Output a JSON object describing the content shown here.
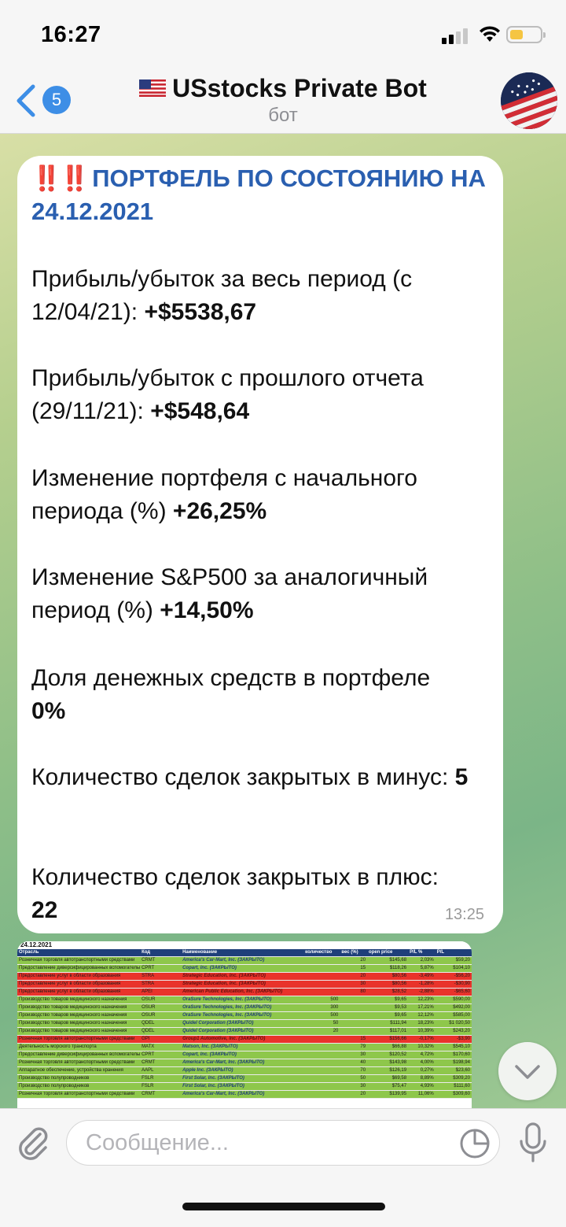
{
  "status_bar": {
    "time": "16:27"
  },
  "header": {
    "back_badge": "5",
    "title": "USstocks Private Bot",
    "subtitle": "бот"
  },
  "message": {
    "title_bangs": "‼️‼️",
    "title": "ПОРТФЕЛЬ ПО СОСТОЯНИЮ НА 24.12.2021",
    "paragraphs": [
      {
        "text": "Прибыль/убыток за весь период (с 12/04/21): ",
        "value": "+$5538,67"
      },
      {
        "text": "Прибыль/убыток с прошлого отчета (29/11/21): ",
        "value": "+$548,64"
      },
      {
        "text": "Изменение портфеля с начального периода (%) ",
        "value": "+26,25%"
      },
      {
        "text": "Изменение S&P500 за аналогичный период (%) ",
        "value": "+14,50%"
      },
      {
        "text": "Доля денежных средств в портфеле ",
        "value": "0%"
      },
      {
        "text": "Количество сделок закрытых в минус: ",
        "value": "5"
      },
      {
        "text": "Количество сделок закрытых в плюс: ",
        "value": "22"
      }
    ],
    "time": "13:25"
  },
  "photo": {
    "date": "24.12.2021",
    "columns": [
      "Отрасль",
      "Код",
      "Наименование",
      "количество",
      "вес (%)",
      "open price",
      "P/L %",
      "P/L"
    ],
    "rows": [
      {
        "s": "g",
        "c": [
          "Розничная торговля автотранспортными средствами",
          "CRMT",
          "America's Car-Mart, Inc. (ЗАКРЫТО)",
          "",
          "20",
          "$145,68",
          "2,03%",
          "$59,20"
        ]
      },
      {
        "s": "g",
        "c": [
          "Предоставление диверсифицированных вспомогательных",
          "CPRT",
          "Copart, Inc. (ЗАКРЫТО)",
          "",
          "15",
          "$118,26",
          "5,87%",
          "$104,10"
        ]
      },
      {
        "s": "r",
        "c": [
          "Предоставление услуг в области образования",
          "STRA",
          "Strategic Education, Inc. (ЗАКРЫТО)",
          "",
          "20",
          "$80,56",
          "-3,49%",
          "-$56,20"
        ]
      },
      {
        "s": "r",
        "c": [
          "Предоставление услуг в области образования",
          "STRA",
          "Strategic Education, Inc. (ЗАКРЫТО)",
          "",
          "30",
          "$80,56",
          "-1,28%",
          "-$30,90"
        ]
      },
      {
        "s": "r",
        "c": [
          "Предоставление услуг в области образования",
          "APEI",
          "American Public Education, Inc. (ЗАКРЫТО)",
          "",
          "80",
          "$28,52",
          "-2,88%",
          "-$65,60"
        ]
      },
      {
        "s": "g",
        "c": [
          "Производство товаров медицинского назначения",
          "OSUR",
          "OraSure Technologies, Inc. (ЗАКРЫТО)",
          "500",
          "",
          "$9,65",
          "12,23%",
          "$590,00"
        ]
      },
      {
        "s": "g",
        "c": [
          "Производство товаров медицинского назначения",
          "OSUR",
          "OraSure Technologies, Inc. (ЗАКРЫТО)",
          "300",
          "",
          "$9,53",
          "17,21%",
          "$492,00"
        ]
      },
      {
        "s": "g",
        "c": [
          "Производство товаров медицинского назначения",
          "OSUR",
          "OraSure Technologies, Inc. (ЗАКРЫТО)",
          "500",
          "",
          "$9,65",
          "12,12%",
          "$585,00"
        ]
      },
      {
        "s": "g",
        "c": [
          "Производство товаров медицинского назначения",
          "QDEL",
          "Quidel Corporation (ЗАКРЫТО)",
          "50",
          "",
          "$111,94",
          "18,23%",
          "$1 020,50"
        ]
      },
      {
        "s": "g",
        "c": [
          "Производство товаров медицинского назначения",
          "QDEL",
          "Quidel Corporation (ЗАКРЫТО)",
          "20",
          "",
          "$117,01",
          "10,39%",
          "$243,20"
        ]
      },
      {
        "s": "r",
        "c": [
          "Розничная торговля автотранспортными средствами",
          "GPI",
          "Group1 Automotive, Inc. (ЗАКРЫТО)",
          "",
          "15",
          "$156,66",
          "-0,17%",
          "-$3,90"
        ]
      },
      {
        "s": "g",
        "c": [
          "Деятельность морского транспорта",
          "MATX",
          "Matson, Inc. (ЗАКРЫТО)",
          "",
          "79",
          "$66,88",
          "10,32%",
          "$545,10"
        ]
      },
      {
        "s": "g",
        "c": [
          "Предоставление диверсифицированных вспомогательных",
          "CPRT",
          "Copart, Inc. (ЗАКРЫТО)",
          "",
          "30",
          "$120,52",
          "4,72%",
          "$170,60"
        ]
      },
      {
        "s": "g",
        "c": [
          "Розничная торговля автотранспортными средствами",
          "CRMT",
          "America's Car-Mart, Inc. (ЗАКРЫТО)",
          "",
          "40",
          "$143,98",
          "4,00%",
          "$198,94"
        ]
      },
      {
        "s": "g",
        "c": [
          "Аппаратное обеспечение, устройства хранения",
          "AAPL",
          "Apple Inc. (ЗАКРЫТО)",
          "",
          "70",
          "$126,19",
          "0,27%",
          "$23,60"
        ]
      },
      {
        "s": "g",
        "c": [
          "Производство полупроводников",
          "FSLR",
          "First Solar, Inc. (ЗАКРЫТО)",
          "",
          "50",
          "$69,58",
          "8,89%",
          "$309,20"
        ]
      },
      {
        "s": "g",
        "c": [
          "Производство полупроводников",
          "FSLR",
          "First Solar, Inc. (ЗАКРЫТО)",
          "",
          "30",
          "$75,47",
          "4,93%",
          "$111,60"
        ]
      },
      {
        "s": "g",
        "c": [
          "Розничная торговля автотранспортными средствами",
          "CRMT",
          "America's Car-Mart, Inc. (ЗАКРЫТО)",
          "",
          "20",
          "$139,95",
          "11,06%",
          "$309,60"
        ]
      }
    ]
  },
  "input": {
    "placeholder": "Сообщение..."
  },
  "colors": {
    "accent": "#3d8ee6",
    "title_blue": "#2a5fb0",
    "bang_red": "#e0302f"
  },
  "icons": [
    "back-chevron-icon",
    "flag-icon",
    "attach-icon",
    "sticker-icon",
    "microphone-icon",
    "chevron-down-icon"
  ]
}
